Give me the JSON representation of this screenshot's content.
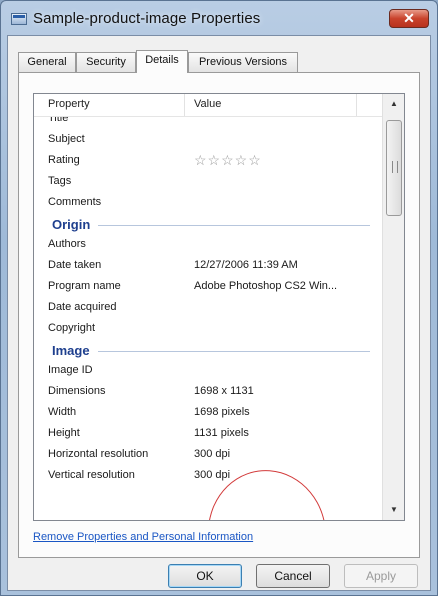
{
  "window": {
    "title": "Sample-product-image Properties",
    "close_label": "✕"
  },
  "tabs": [
    {
      "label": "General"
    },
    {
      "label": "Security"
    },
    {
      "label": "Details"
    },
    {
      "label": "Previous Versions"
    }
  ],
  "active_tab": "Details",
  "list": {
    "col_property": "Property",
    "col_value": "Value",
    "rows": [
      {
        "kind": "item",
        "property": "Title",
        "value": ""
      },
      {
        "kind": "item",
        "property": "Subject",
        "value": ""
      },
      {
        "kind": "rating",
        "property": "Rating",
        "stars": "☆☆☆☆☆",
        "rating_value": 0
      },
      {
        "kind": "item",
        "property": "Tags",
        "value": ""
      },
      {
        "kind": "item",
        "property": "Comments",
        "value": ""
      },
      {
        "kind": "section",
        "title": "Origin"
      },
      {
        "kind": "item",
        "property": "Authors",
        "value": ""
      },
      {
        "kind": "item",
        "property": "Date taken",
        "value": "12/27/2006 11:39 AM"
      },
      {
        "kind": "item",
        "property": "Program name",
        "value": "Adobe Photoshop CS2 Win..."
      },
      {
        "kind": "item",
        "property": "Date acquired",
        "value": ""
      },
      {
        "kind": "item",
        "property": "Copyright",
        "value": ""
      },
      {
        "kind": "section",
        "title": "Image"
      },
      {
        "kind": "item",
        "property": "Image ID",
        "value": ""
      },
      {
        "kind": "item",
        "property": "Dimensions",
        "value": "1698 x 1131"
      },
      {
        "kind": "item",
        "property": "Width",
        "value": "1698 pixels"
      },
      {
        "kind": "item",
        "property": "Height",
        "value": "1131 pixels"
      },
      {
        "kind": "item",
        "property": "Horizontal resolution",
        "value": "300 dpi"
      },
      {
        "kind": "item",
        "property": "Vertical resolution",
        "value": "300 dpi"
      }
    ]
  },
  "remove_link": "Remove Properties and Personal Information",
  "buttons": {
    "ok": "OK",
    "cancel": "Cancel",
    "apply": "Apply"
  },
  "icons": {
    "scroll_up": "▲",
    "scroll_down": "▼"
  },
  "colors": {
    "annotation_circle": "#d23a3a",
    "section_title": "#1e3f8e",
    "link": "#1a56c4"
  }
}
